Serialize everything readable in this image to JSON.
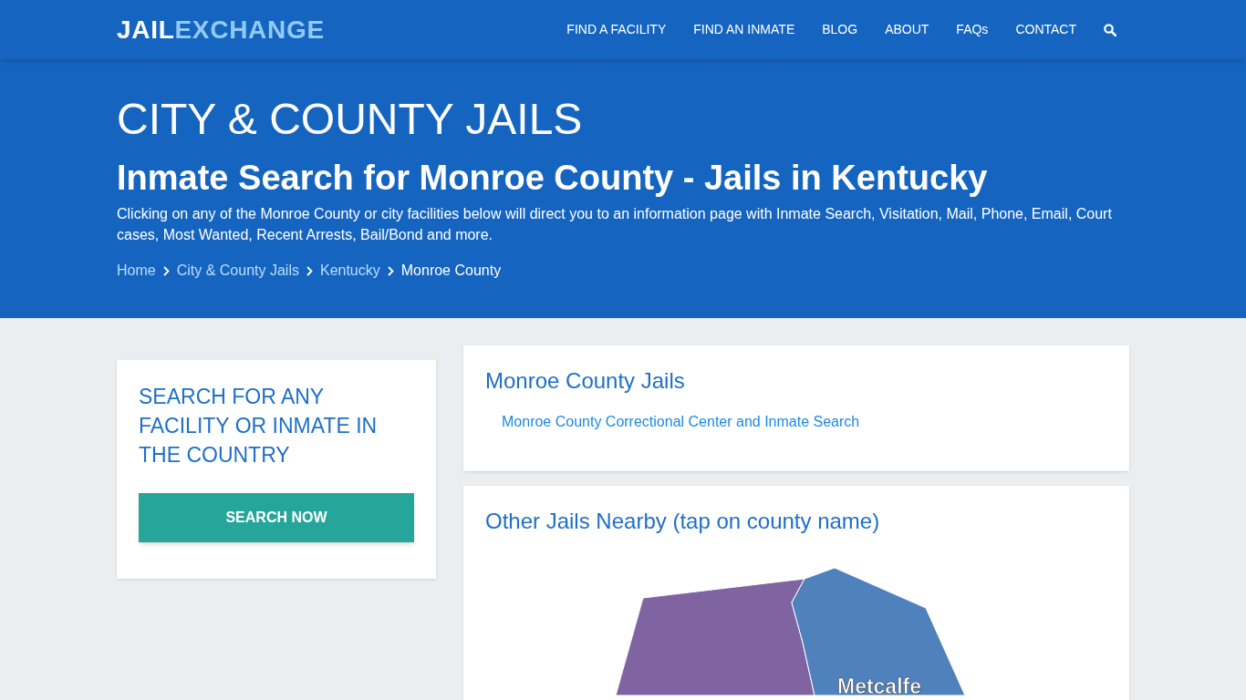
{
  "logo": {
    "first": "JAIL",
    "second": "EXCHANGE"
  },
  "nav": [
    "FIND A FACILITY",
    "FIND AN INMATE",
    "BLOG",
    "ABOUT",
    "FAQs",
    "CONTACT"
  ],
  "hero": {
    "title": "CITY & COUNTY JAILS",
    "subtitle": "Inmate Search for Monroe County - Jails in Kentucky",
    "description": "Clicking on any of the Monroe County or city facilities below will direct you to an information page with Inmate Search, Visitation, Mail, Phone, Email, Court cases, Most Wanted, Recent Arrests, Bail/Bond and more.",
    "breadcrumbs": [
      {
        "label": "Home",
        "current": false
      },
      {
        "label": "City & County Jails",
        "current": false
      },
      {
        "label": "Kentucky",
        "current": false
      },
      {
        "label": "Monroe County",
        "current": true
      }
    ]
  },
  "search_card": {
    "heading": "SEARCH FOR ANY FACILITY OR INMATE IN THE COUNTRY",
    "button": "SEARCH NOW"
  },
  "jails_card": {
    "heading": "Monroe County Jails",
    "links": [
      "Monroe County Correctional Center and Inmate Search"
    ]
  },
  "nearby_card": {
    "heading": "Other Jails Nearby (tap on county name)",
    "counties": [
      {
        "color": "#8064a2"
      },
      {
        "name": "Metcalfe",
        "color": "#4f81bd"
      }
    ]
  }
}
